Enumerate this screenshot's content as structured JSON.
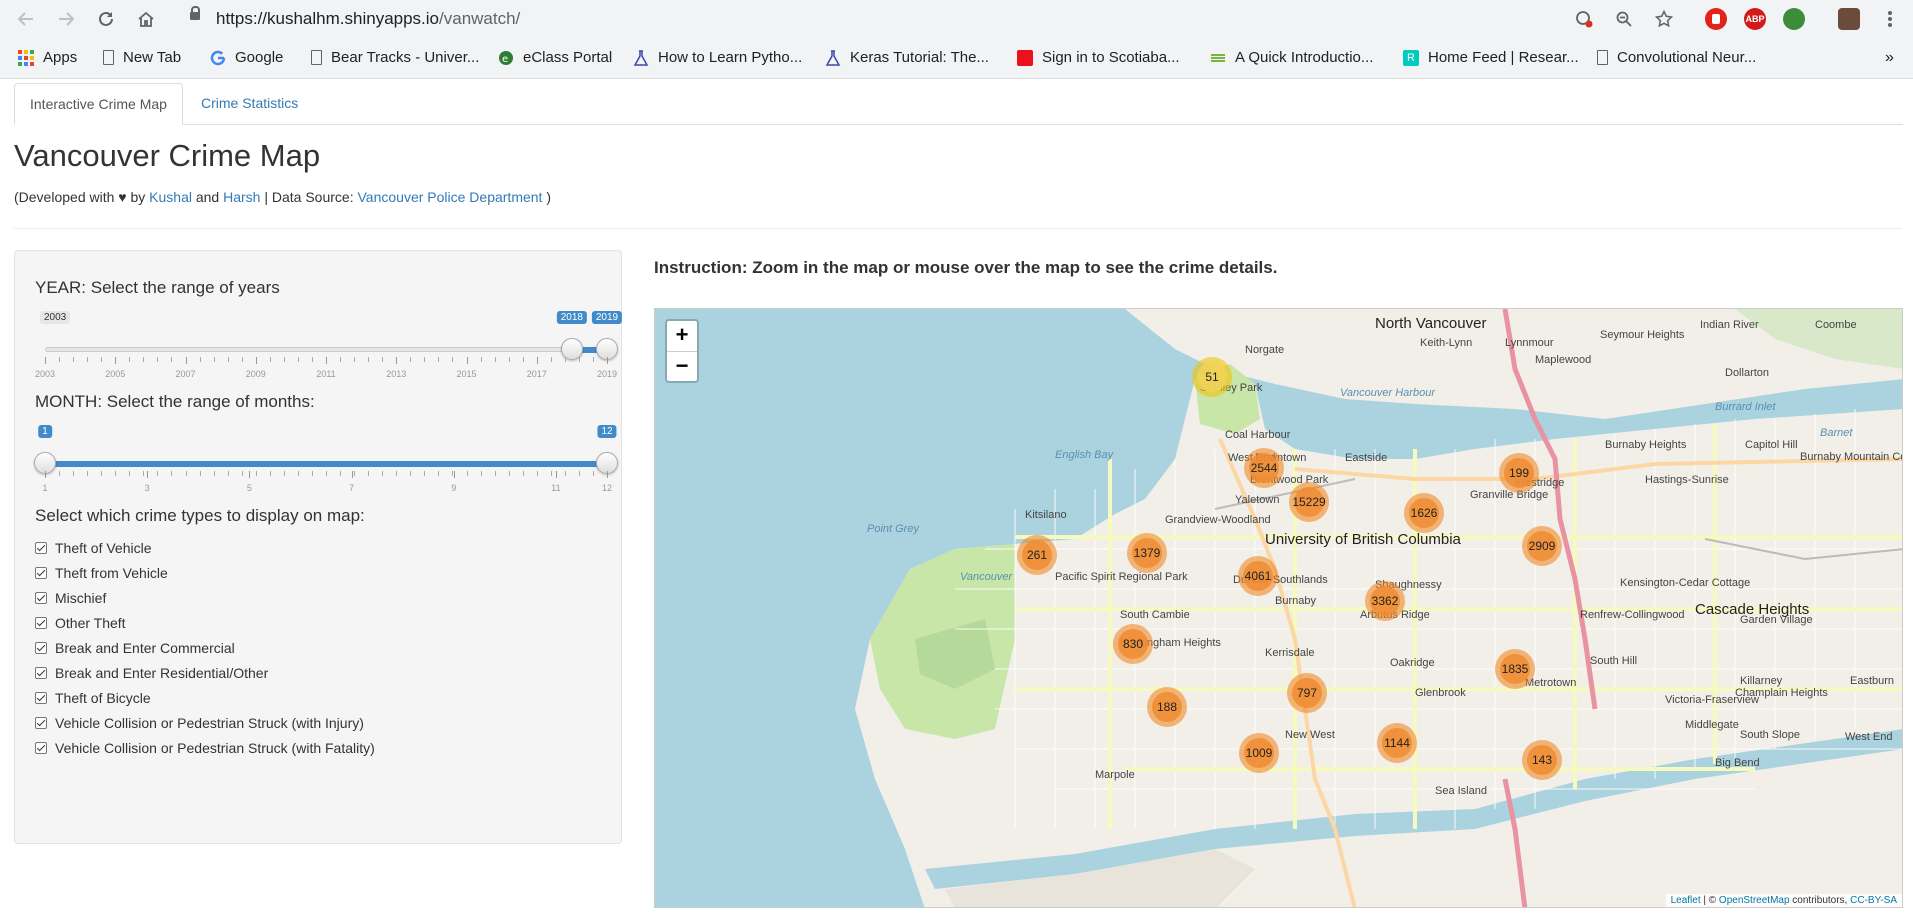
{
  "browser": {
    "url_host": "https://kushalhm.shinyapps.io",
    "url_path": "/vanwatch/",
    "bookmarks": [
      {
        "label": "Apps",
        "icon": "apps-grid-icon"
      },
      {
        "label": "New Tab",
        "icon": "page-icon"
      },
      {
        "label": "Google",
        "icon": "google-icon"
      },
      {
        "label": "Bear Tracks - Univer...",
        "icon": "page-icon"
      },
      {
        "label": "eClass Portal",
        "icon": "eclass-icon"
      },
      {
        "label": "How to Learn Pytho...",
        "icon": "flask-icon"
      },
      {
        "label": "Keras Tutorial: The...",
        "icon": "flask-icon"
      },
      {
        "label": "Sign in to Scotiaba...",
        "icon": "scotiabank-icon"
      },
      {
        "label": "A Quick Introductio...",
        "icon": "site-icon"
      },
      {
        "label": "Home Feed | Resear...",
        "icon": "researchgate-icon"
      },
      {
        "label": "Convolutional Neur...",
        "icon": "page-icon"
      }
    ],
    "extensions": {
      "adblock": "ABP"
    }
  },
  "tabs": [
    {
      "label": "Interactive Crime Map",
      "active": true
    },
    {
      "label": "Crime Statistics",
      "active": false
    }
  ],
  "header": {
    "title": "Vancouver Crime Map",
    "credits_prefix": "(Developed with ♥ by",
    "author1": "Kushal",
    "and": "and",
    "author2": "Harsh",
    "source_prefix": "| Data Source:",
    "source": "Vancouver Police Department",
    "credits_suffix": ")"
  },
  "year_slider": {
    "label": "YEAR: Select the range of years",
    "min": 2003,
    "max": 2019,
    "from": 2018,
    "to": 2019,
    "min_label": "2003",
    "from_label": "2018",
    "to_label": "2019",
    "tick_labels": [
      "2003",
      "2005",
      "2007",
      "2009",
      "2011",
      "2013",
      "2015",
      "2017",
      "2019"
    ]
  },
  "month_slider": {
    "label": "MONTH: Select the range of months:",
    "min": 1,
    "max": 12,
    "from": 1,
    "to": 12,
    "from_label": "1",
    "to_label": "12",
    "tick_labels": [
      "1",
      "3",
      "5",
      "7",
      "9",
      "11",
      "12"
    ]
  },
  "crime_types": {
    "label": "Select which crime types to display on map:",
    "items": [
      {
        "label": "Theft of Vehicle",
        "checked": true
      },
      {
        "label": "Theft from Vehicle",
        "checked": true
      },
      {
        "label": "Mischief",
        "checked": true
      },
      {
        "label": "Other Theft",
        "checked": true
      },
      {
        "label": "Break and Enter Commercial",
        "checked": true
      },
      {
        "label": "Break and Enter Residential/Other",
        "checked": true
      },
      {
        "label": "Theft of Bicycle",
        "checked": true
      },
      {
        "label": "Vehicle Collision or Pedestrian Struck (with Injury)",
        "checked": true
      },
      {
        "label": "Vehicle Collision or Pedestrian Struck (with Fatality)",
        "checked": true
      }
    ]
  },
  "map": {
    "instruction": "Instruction: Zoom in the map or mouse over the map to see the crime details.",
    "zoom_in": "+",
    "zoom_out": "−",
    "clusters": [
      "51",
      "2544",
      "15229",
      "1626",
      "199",
      "2909",
      "261",
      "1379",
      "4061",
      "3362",
      "830",
      "1835",
      "797",
      "188",
      "1009",
      "1144",
      "143"
    ],
    "places": [
      "North Vancouver",
      "Keith-Lynn",
      "Lynnmour",
      "Seymour Heights",
      "Indian River",
      "Coombe",
      "Norgate",
      "Maplewood",
      "Dollarton",
      "Stanley Park",
      "Vancouver Harbour",
      "Burrard Inlet",
      "Coal Harbour",
      "West End",
      "Downtown",
      "Eastside",
      "English Bay",
      "Burnaby Heights",
      "Capitol Hill",
      "Barnet",
      "Burnaby Mountain Conservation Area",
      "Westridge",
      "Hastings-Sunrise",
      "Brentwood Park",
      "Yaletown",
      "Granville Bridge",
      "Grandview-Woodland",
      "Kitsilano",
      "Point Grey",
      "University of British Columbia",
      "Vancouver",
      "Pacific Spirit Regional Park",
      "Dunbar-Southlands",
      "Shaughnessy",
      "Kensington-Cedar Cottage",
      "Cascade Heights",
      "Burnaby",
      "South Cambie",
      "Arbutus Ridge",
      "Renfrew-Collingwood",
      "Garden Village",
      "Buckingham Heights",
      "Kerrisdale",
      "Oakridge",
      "South Hill",
      "Metrotown",
      "Killarney",
      "Eastburn",
      "Glenbrook",
      "Victoria-Fraserview",
      "Champlain Heights",
      "Middlegate",
      "South Slope",
      "West End",
      "New West",
      "Marpole",
      "Sea Island",
      "Big Bend"
    ],
    "attribution": {
      "leaflet": "Leaflet",
      "sep": " | © ",
      "osm": "OpenStreetMap",
      "contributors": " contributors, ",
      "license": "CC-BY-SA"
    }
  },
  "colors": {
    "link": "#337ab7",
    "slider_bar": "#428bca",
    "cluster_medium": "#f08c32",
    "cluster_small": "#f1d357",
    "water": "#aad3df",
    "land": "#f2efe9",
    "park": "#c8e6a8"
  }
}
